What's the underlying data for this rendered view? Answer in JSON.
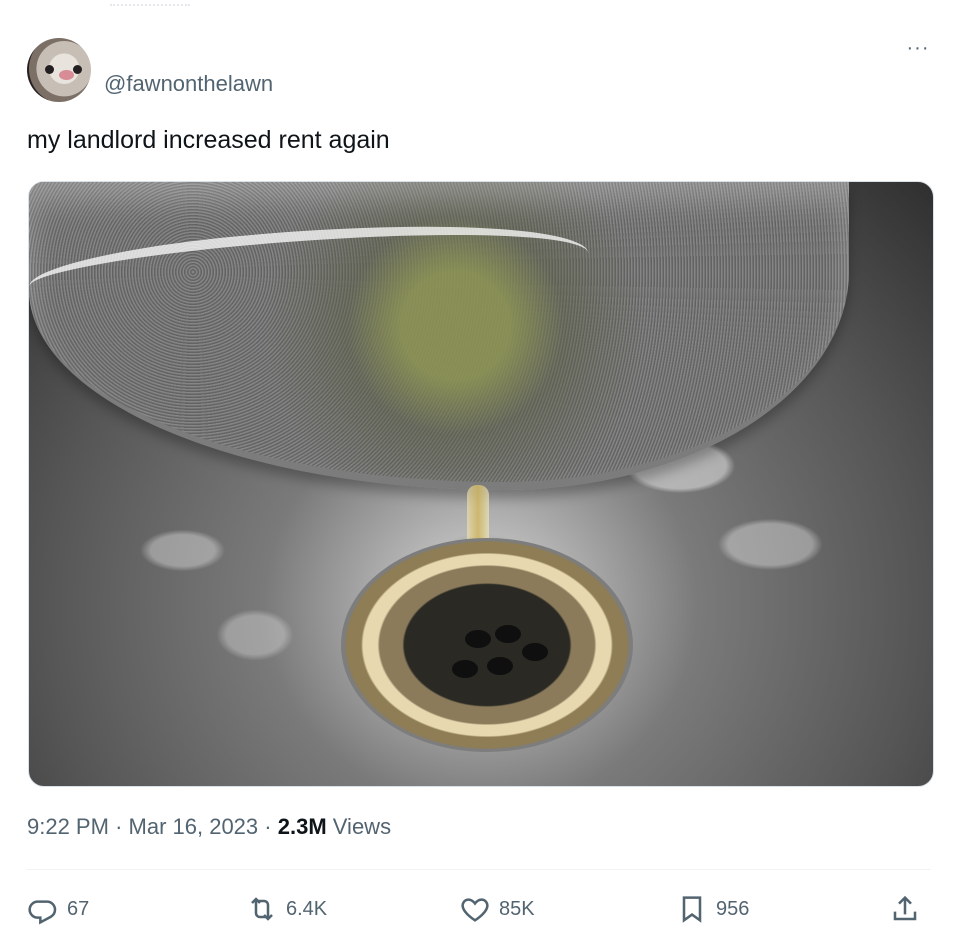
{
  "tweet": {
    "handle": "@fawnonthelawn",
    "text": "my landlord increased rent again",
    "menu_label": "···",
    "time": "9:22 PM",
    "separator_1": "·",
    "date": "Mar 16, 2023",
    "separator_2": "·",
    "views_count": "2.3M",
    "views_label": "Views"
  },
  "actions": {
    "replies": "67",
    "reposts": "6.4K",
    "likes": "85K",
    "bookmarks": "956"
  },
  "icons": {
    "avatar": "cat-avatar",
    "menu": "more-icon",
    "reply": "reply-icon",
    "repost": "repost-icon",
    "like": "heart-icon",
    "bookmark": "bookmark-icon",
    "share": "share-icon"
  },
  "colors": {
    "text": "#0f1419",
    "muted": "#536471",
    "divider": "#eff3f4",
    "background": "#ffffff"
  }
}
